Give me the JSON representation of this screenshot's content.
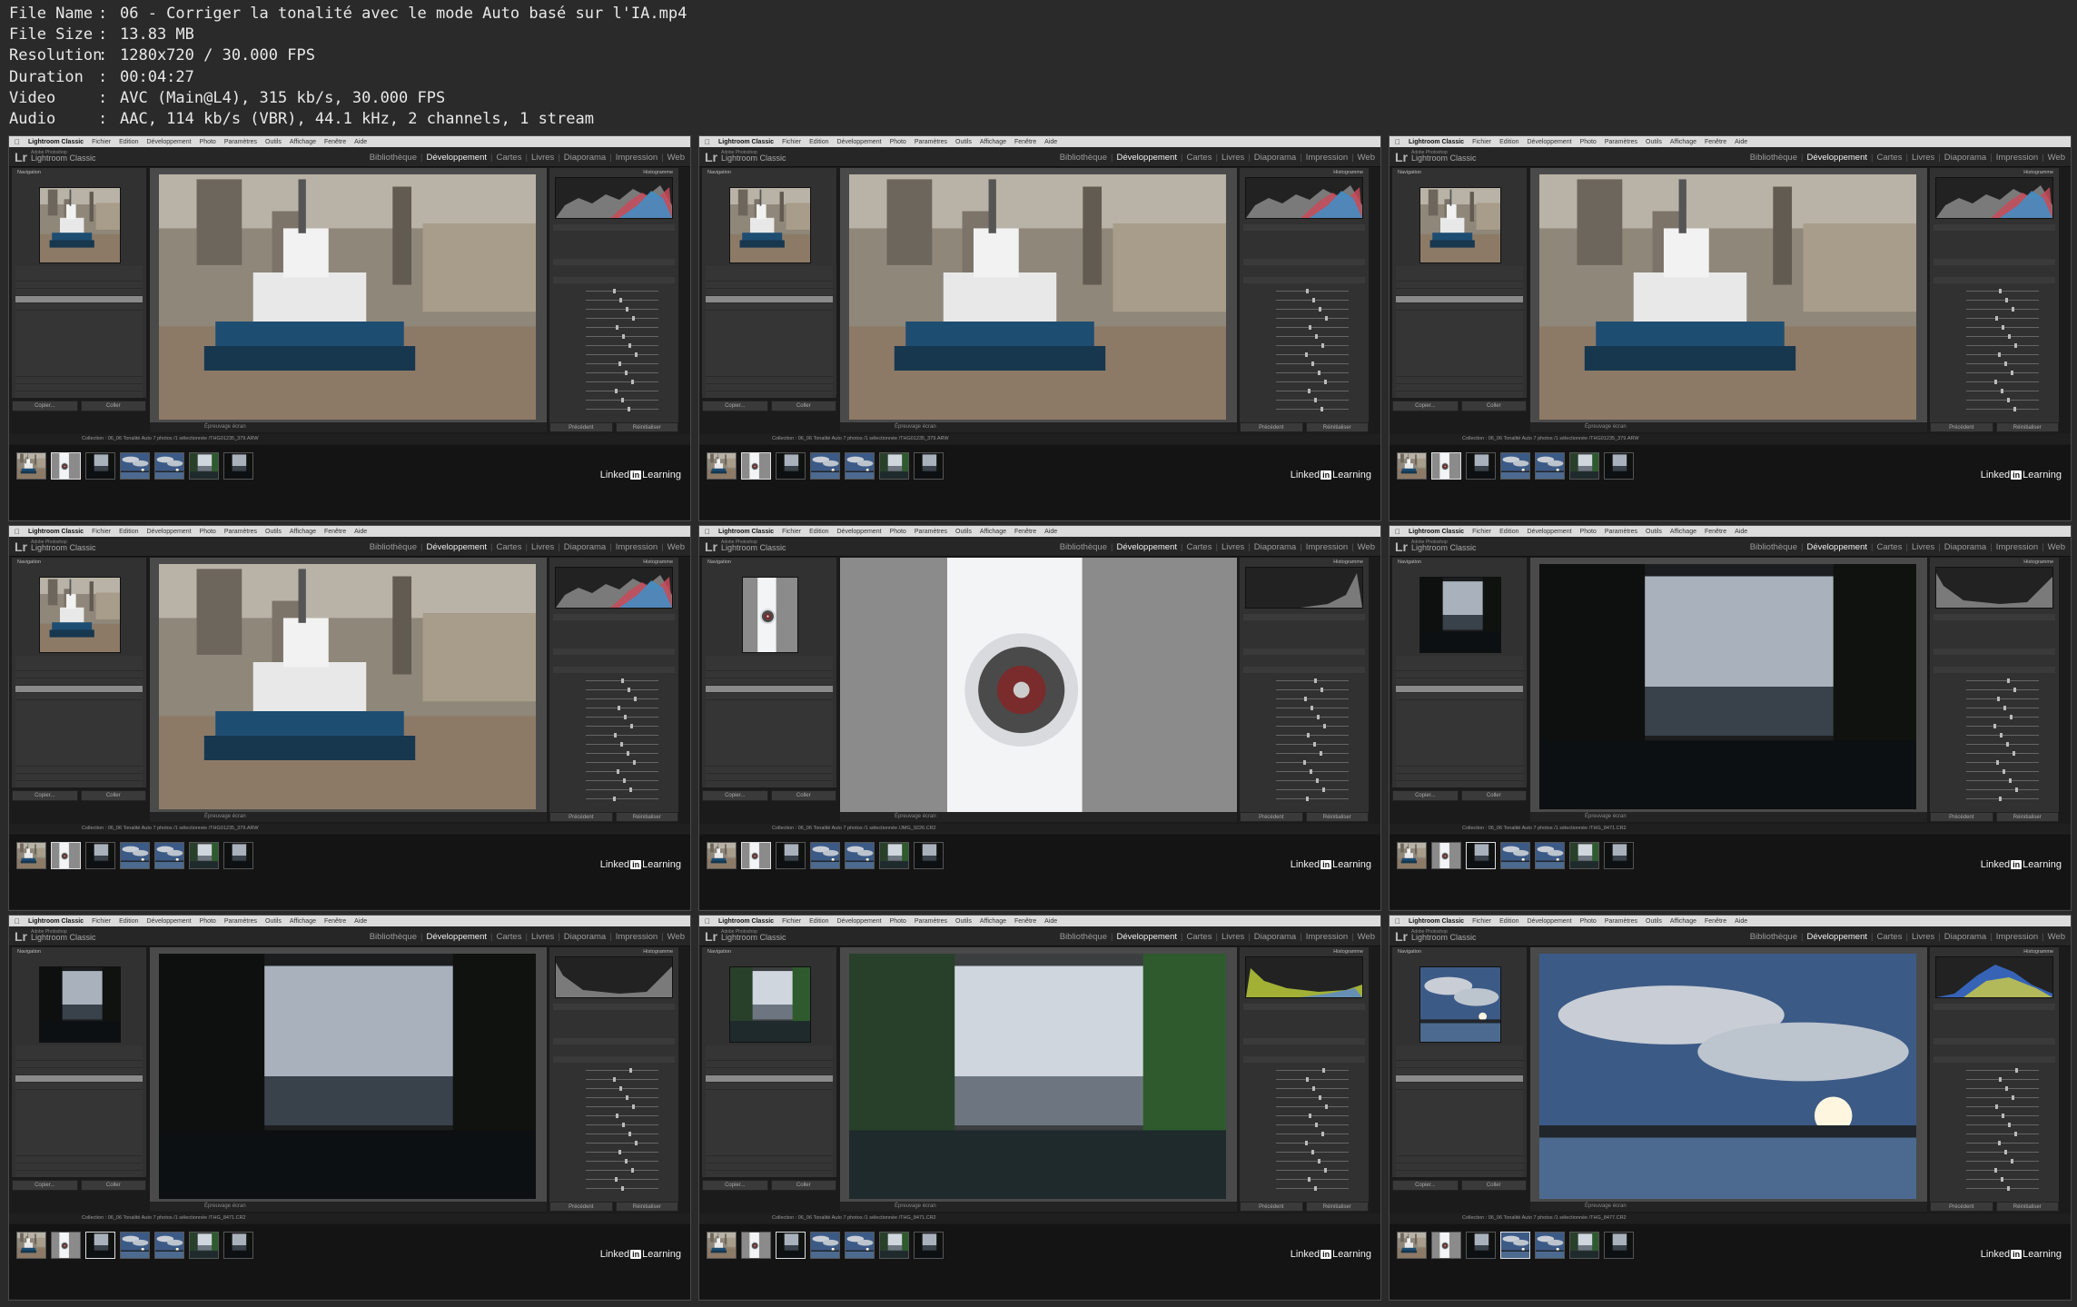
{
  "info": [
    {
      "key": "File Name",
      "value": "06 - Corriger la tonalité avec le mode Auto basé sur l'IA.mp4"
    },
    {
      "key": "File Size",
      "value": "13.83 MB"
    },
    {
      "key": "Resolution",
      "value": "1280x720 / 30.000 FPS"
    },
    {
      "key": "Duration",
      "value": "00:04:27"
    },
    {
      "key": "Video",
      "value": "AVC (Main@L4), 315 kb/s, 30.000 FPS"
    },
    {
      "key": "Audio",
      "value": "AAC, 114 kb/s (VBR), 44.1 kHz, 2 channels, 1 stream"
    }
  ],
  "info_separator": ":",
  "app": {
    "menubar": [
      "Lightroom Classic",
      "Fichier",
      "Edition",
      "Développement",
      "Photo",
      "Paramètres",
      "Outils",
      "Affichage",
      "Fenêtre",
      "Aide"
    ],
    "logo": "Lr",
    "brand_small": "Adobe Photoshop",
    "brand_name": "Lightroom Classic",
    "modules": [
      "Bibliothèque",
      "Développement",
      "Cartes",
      "Livres",
      "Diaporama",
      "Impression",
      "Web"
    ],
    "active_module": "Développement",
    "module_separator": "|",
    "navigator_label": "Navigation",
    "histogram_label": "Histogramme",
    "left_buttons": [
      "Copier...",
      "Coller"
    ],
    "right_buttons": [
      "Précédent",
      "Réinitialiser"
    ],
    "toolbar_label": "Épreuvage écran",
    "collection_prefix": "Collection : 06_06 Tonalité Auto",
    "photo_count": "7 photos /1 sélectionnée /",
    "linkedin": {
      "text": "Linked",
      "badge": "in",
      "suffix": "Learning"
    }
  },
  "frames": [
    {
      "scene": "tugboat",
      "file": "THG01235_379.ARW",
      "selected_thumb": 1
    },
    {
      "scene": "tugboat",
      "file": "THG01235_379.ARW",
      "selected_thumb": 1
    },
    {
      "scene": "tugboat",
      "file": "THG01235_379.ARW",
      "selected_thumb": 1
    },
    {
      "scene": "tugboat",
      "file": "THG01235_379.ARW",
      "selected_thumb": 1
    },
    {
      "scene": "jet-engine",
      "file": "JMG_9226.CR2",
      "selected_thumb": 1
    },
    {
      "scene": "forest-dark",
      "file": "THG_8471.CR2",
      "selected_thumb": 2
    },
    {
      "scene": "forest-dark",
      "file": "THG_8471.CR2",
      "selected_thumb": 2
    },
    {
      "scene": "forest-bright",
      "file": "THG_8471.CR2",
      "selected_thumb": 2
    },
    {
      "scene": "sky-lake",
      "file": "THG_8477.CR2",
      "selected_thumb": 3
    }
  ],
  "colors": {
    "accent": "#f0f0f0",
    "panel": "#313131",
    "background": "#2a2a2a"
  }
}
